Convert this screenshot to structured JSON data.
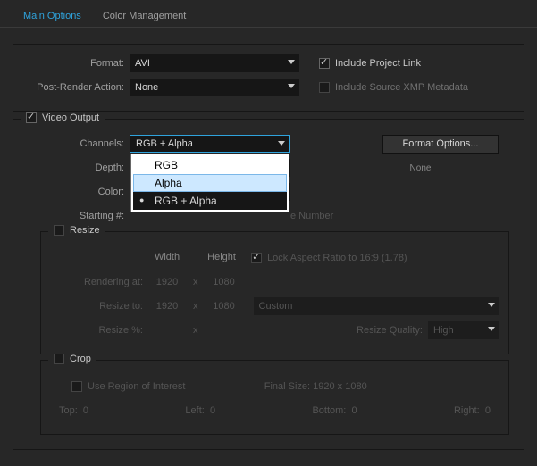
{
  "tabs": {
    "main": "Main Options",
    "color": "Color Management"
  },
  "top": {
    "format_label": "Format:",
    "format_value": "AVI",
    "include_link": "Include Project Link",
    "post_render_label": "Post-Render Action:",
    "post_render_value": "None",
    "include_xmp": "Include Source XMP Metadata"
  },
  "video": {
    "header": "Video Output",
    "channels_label": "Channels:",
    "channels_value": "RGB + Alpha",
    "channels_options": {
      "rgb": "RGB",
      "alpha": "Alpha",
      "rgba": "RGB + Alpha"
    },
    "format_options_btn": "Format Options...",
    "depth_label": "Depth:",
    "depth_note": "None",
    "color_label": "Color:",
    "starting_label": "Starting #:",
    "starting_hint": "e Number"
  },
  "resize": {
    "header": "Resize",
    "width": "Width",
    "height": "Height",
    "lock": "Lock Aspect Ratio to 16:9 (1.78)",
    "rendering_at": "Rendering at:",
    "r_w": "1920",
    "r_h": "1080",
    "resize_to": "Resize to:",
    "t_w": "1920",
    "t_h": "1080",
    "custom": "Custom",
    "resize_pct": "Resize %:",
    "quality_label": "Resize Quality:",
    "quality_value": "High"
  },
  "crop": {
    "header": "Crop",
    "roi": "Use Region of Interest",
    "final": "Final Size: 1920 x 1080",
    "top": "Top:",
    "left": "Left:",
    "bottom": "Bottom:",
    "right": "Right:",
    "zero": "0"
  }
}
